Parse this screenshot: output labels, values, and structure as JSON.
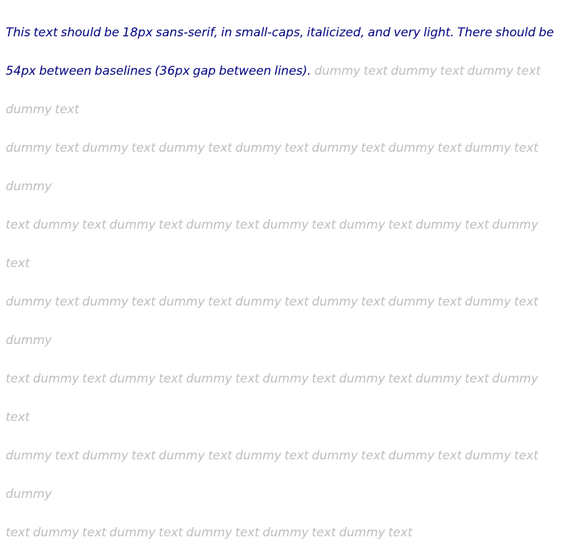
{
  "instruction": "This text should be 18px sans-serif, in small-caps, italicized, and very light. There should be 54px between baselines (36px gap between lines).",
  "filler_lines": [
    " dummy text dummy text dummy text dummy text",
    "dummy text dummy text dummy text dummy text dummy text dummy text dummy text dummy",
    "text dummy text dummy text dummy text dummy text dummy text dummy text dummy text",
    "dummy text dummy text dummy text dummy text dummy text dummy text dummy text dummy",
    "text dummy text dummy text dummy text dummy text dummy text dummy text dummy text",
    "dummy text dummy text dummy text dummy text dummy text dummy text dummy text dummy",
    "text dummy text dummy text dummy text dummy text dummy text"
  ],
  "colors": {
    "instruction": "#000080",
    "filler": "#bdbdbd",
    "background": "#ffffff"
  }
}
